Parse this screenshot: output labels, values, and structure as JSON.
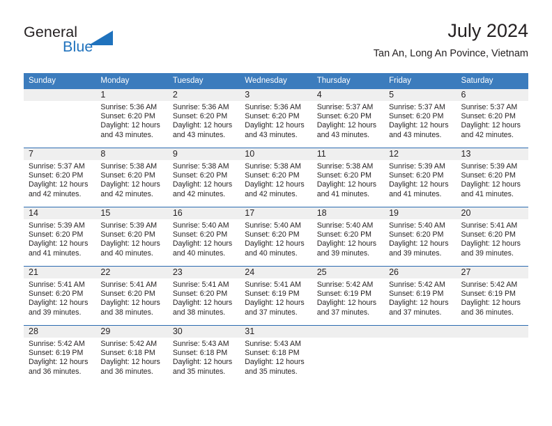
{
  "brand": {
    "name_part1": "General",
    "name_part2": "Blue",
    "logo_icon": "triangle-logo-icon",
    "color_dark": "#231f20",
    "color_blue": "#1f72bd"
  },
  "header": {
    "title": "July 2024",
    "subtitle": "Tan An, Long An Povince, Vietnam"
  },
  "theme": {
    "header_row_bg": "#3c7cbd",
    "week_divider": "#2a6ab0",
    "daynum_band_bg": "#efefef",
    "text": "#231f20"
  },
  "columns": [
    "Sunday",
    "Monday",
    "Tuesday",
    "Wednesday",
    "Thursday",
    "Friday",
    "Saturday"
  ],
  "weeks": [
    [
      {
        "day": "",
        "lines": []
      },
      {
        "day": "1",
        "lines": [
          "Sunrise: 5:36 AM",
          "Sunset: 6:20 PM",
          "Daylight: 12 hours",
          "and 43 minutes."
        ]
      },
      {
        "day": "2",
        "lines": [
          "Sunrise: 5:36 AM",
          "Sunset: 6:20 PM",
          "Daylight: 12 hours",
          "and 43 minutes."
        ]
      },
      {
        "day": "3",
        "lines": [
          "Sunrise: 5:36 AM",
          "Sunset: 6:20 PM",
          "Daylight: 12 hours",
          "and 43 minutes."
        ]
      },
      {
        "day": "4",
        "lines": [
          "Sunrise: 5:37 AM",
          "Sunset: 6:20 PM",
          "Daylight: 12 hours",
          "and 43 minutes."
        ]
      },
      {
        "day": "5",
        "lines": [
          "Sunrise: 5:37 AM",
          "Sunset: 6:20 PM",
          "Daylight: 12 hours",
          "and 43 minutes."
        ]
      },
      {
        "day": "6",
        "lines": [
          "Sunrise: 5:37 AM",
          "Sunset: 6:20 PM",
          "Daylight: 12 hours",
          "and 42 minutes."
        ]
      }
    ],
    [
      {
        "day": "7",
        "lines": [
          "Sunrise: 5:37 AM",
          "Sunset: 6:20 PM",
          "Daylight: 12 hours",
          "and 42 minutes."
        ]
      },
      {
        "day": "8",
        "lines": [
          "Sunrise: 5:38 AM",
          "Sunset: 6:20 PM",
          "Daylight: 12 hours",
          "and 42 minutes."
        ]
      },
      {
        "day": "9",
        "lines": [
          "Sunrise: 5:38 AM",
          "Sunset: 6:20 PM",
          "Daylight: 12 hours",
          "and 42 minutes."
        ]
      },
      {
        "day": "10",
        "lines": [
          "Sunrise: 5:38 AM",
          "Sunset: 6:20 PM",
          "Daylight: 12 hours",
          "and 42 minutes."
        ]
      },
      {
        "day": "11",
        "lines": [
          "Sunrise: 5:38 AM",
          "Sunset: 6:20 PM",
          "Daylight: 12 hours",
          "and 41 minutes."
        ]
      },
      {
        "day": "12",
        "lines": [
          "Sunrise: 5:39 AM",
          "Sunset: 6:20 PM",
          "Daylight: 12 hours",
          "and 41 minutes."
        ]
      },
      {
        "day": "13",
        "lines": [
          "Sunrise: 5:39 AM",
          "Sunset: 6:20 PM",
          "Daylight: 12 hours",
          "and 41 minutes."
        ]
      }
    ],
    [
      {
        "day": "14",
        "lines": [
          "Sunrise: 5:39 AM",
          "Sunset: 6:20 PM",
          "Daylight: 12 hours",
          "and 41 minutes."
        ]
      },
      {
        "day": "15",
        "lines": [
          "Sunrise: 5:39 AM",
          "Sunset: 6:20 PM",
          "Daylight: 12 hours",
          "and 40 minutes."
        ]
      },
      {
        "day": "16",
        "lines": [
          "Sunrise: 5:40 AM",
          "Sunset: 6:20 PM",
          "Daylight: 12 hours",
          "and 40 minutes."
        ]
      },
      {
        "day": "17",
        "lines": [
          "Sunrise: 5:40 AM",
          "Sunset: 6:20 PM",
          "Daylight: 12 hours",
          "and 40 minutes."
        ]
      },
      {
        "day": "18",
        "lines": [
          "Sunrise: 5:40 AM",
          "Sunset: 6:20 PM",
          "Daylight: 12 hours",
          "and 39 minutes."
        ]
      },
      {
        "day": "19",
        "lines": [
          "Sunrise: 5:40 AM",
          "Sunset: 6:20 PM",
          "Daylight: 12 hours",
          "and 39 minutes."
        ]
      },
      {
        "day": "20",
        "lines": [
          "Sunrise: 5:41 AM",
          "Sunset: 6:20 PM",
          "Daylight: 12 hours",
          "and 39 minutes."
        ]
      }
    ],
    [
      {
        "day": "21",
        "lines": [
          "Sunrise: 5:41 AM",
          "Sunset: 6:20 PM",
          "Daylight: 12 hours",
          "and 39 minutes."
        ]
      },
      {
        "day": "22",
        "lines": [
          "Sunrise: 5:41 AM",
          "Sunset: 6:20 PM",
          "Daylight: 12 hours",
          "and 38 minutes."
        ]
      },
      {
        "day": "23",
        "lines": [
          "Sunrise: 5:41 AM",
          "Sunset: 6:20 PM",
          "Daylight: 12 hours",
          "and 38 minutes."
        ]
      },
      {
        "day": "24",
        "lines": [
          "Sunrise: 5:41 AM",
          "Sunset: 6:19 PM",
          "Daylight: 12 hours",
          "and 37 minutes."
        ]
      },
      {
        "day": "25",
        "lines": [
          "Sunrise: 5:42 AM",
          "Sunset: 6:19 PM",
          "Daylight: 12 hours",
          "and 37 minutes."
        ]
      },
      {
        "day": "26",
        "lines": [
          "Sunrise: 5:42 AM",
          "Sunset: 6:19 PM",
          "Daylight: 12 hours",
          "and 37 minutes."
        ]
      },
      {
        "day": "27",
        "lines": [
          "Sunrise: 5:42 AM",
          "Sunset: 6:19 PM",
          "Daylight: 12 hours",
          "and 36 minutes."
        ]
      }
    ],
    [
      {
        "day": "28",
        "lines": [
          "Sunrise: 5:42 AM",
          "Sunset: 6:19 PM",
          "Daylight: 12 hours",
          "and 36 minutes."
        ]
      },
      {
        "day": "29",
        "lines": [
          "Sunrise: 5:42 AM",
          "Sunset: 6:18 PM",
          "Daylight: 12 hours",
          "and 36 minutes."
        ]
      },
      {
        "day": "30",
        "lines": [
          "Sunrise: 5:43 AM",
          "Sunset: 6:18 PM",
          "Daylight: 12 hours",
          "and 35 minutes."
        ]
      },
      {
        "day": "31",
        "lines": [
          "Sunrise: 5:43 AM",
          "Sunset: 6:18 PM",
          "Daylight: 12 hours",
          "and 35 minutes."
        ]
      },
      {
        "day": "",
        "lines": []
      },
      {
        "day": "",
        "lines": []
      },
      {
        "day": "",
        "lines": []
      }
    ]
  ]
}
